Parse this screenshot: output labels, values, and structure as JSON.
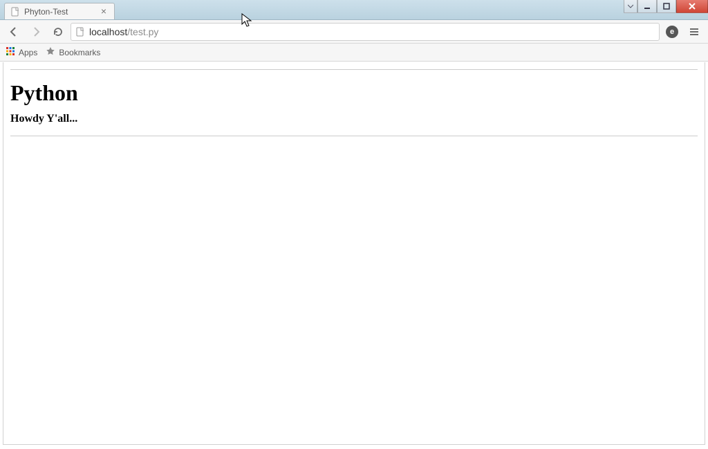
{
  "active_tab": {
    "title": "Phyton-Test"
  },
  "url": {
    "host": "localhost",
    "path": "/test.py"
  },
  "bookmarks_bar": {
    "apps_label": "Apps",
    "bookmarks_label": "Bookmarks"
  },
  "profile_initial": "e",
  "page": {
    "heading": "Python",
    "subheading": "Howdy Y'all..."
  }
}
